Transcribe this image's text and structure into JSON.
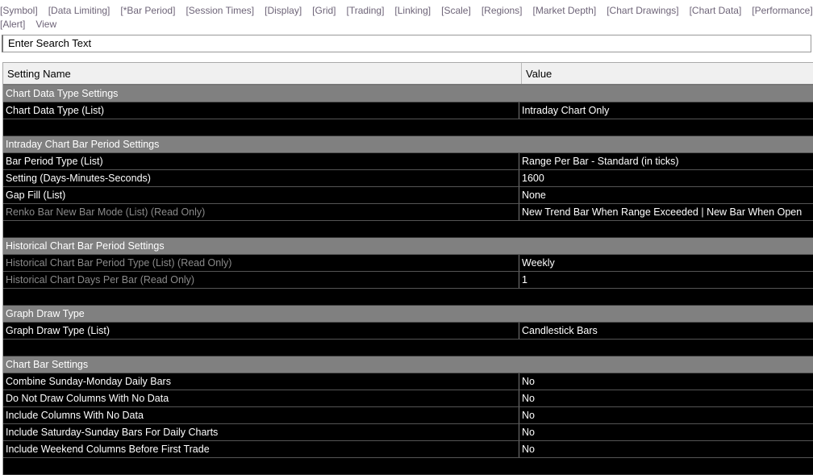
{
  "menu_row1": [
    "[Symbol]",
    "[Data Limiting]",
    "[*Bar Period]",
    "[Session Times]",
    "[Display]",
    "[Grid]",
    "[Trading]",
    "[Linking]",
    "[Scale]",
    "[Regions]",
    "[Market Depth]",
    "[Chart Drawings]",
    "[Chart Data]",
    "[Performance]"
  ],
  "menu_row2": [
    "[Alert]",
    "View"
  ],
  "search": {
    "placeholder": "Enter Search Text"
  },
  "table": {
    "headers": [
      "Setting Name",
      "Value"
    ]
  },
  "sections": [
    {
      "title": "Chart Data Type Settings",
      "rows": [
        {
          "name": "Chart Data Type (List)",
          "value": "Intraday Chart Only",
          "ro": false
        }
      ]
    },
    {
      "title": "Intraday Chart Bar Period Settings",
      "rows": [
        {
          "name": "Bar Period Type (List)",
          "value": "Range Per Bar - Standard (in ticks)",
          "ro": false
        },
        {
          "name": "Setting (Days-Minutes-Seconds)",
          "value": "1600",
          "ro": false
        },
        {
          "name": "Gap Fill (List)",
          "value": "None",
          "ro": false
        },
        {
          "name": "Renko Bar New Bar Mode (List) (Read Only)",
          "value": "New Trend Bar When Range Exceeded | New Bar When Open",
          "ro": true
        }
      ]
    },
    {
      "title": "Historical Chart Bar Period Settings",
      "rows": [
        {
          "name": "Historical Chart Bar Period Type (List) (Read Only)",
          "value": "Weekly",
          "ro": true
        },
        {
          "name": "Historical Chart Days Per Bar (Read Only)",
          "value": "1",
          "ro": true
        }
      ]
    },
    {
      "title": "Graph Draw Type",
      "rows": [
        {
          "name": "Graph Draw Type (List)",
          "value": "Candlestick Bars",
          "ro": false
        }
      ]
    },
    {
      "title": "Chart Bar Settings",
      "rows": [
        {
          "name": "Combine Sunday-Monday Daily Bars",
          "value": "No",
          "ro": false
        },
        {
          "name": "Do Not Draw Columns With No Data",
          "value": "No",
          "ro": false
        },
        {
          "name": "Include Columns With No Data",
          "value": "No",
          "ro": false
        },
        {
          "name": "Include Saturday-Sunday Bars For Daily Charts",
          "value": "No",
          "ro": false
        },
        {
          "name": "Include Weekend Columns Before First Trade",
          "value": "No",
          "ro": false
        }
      ]
    }
  ]
}
